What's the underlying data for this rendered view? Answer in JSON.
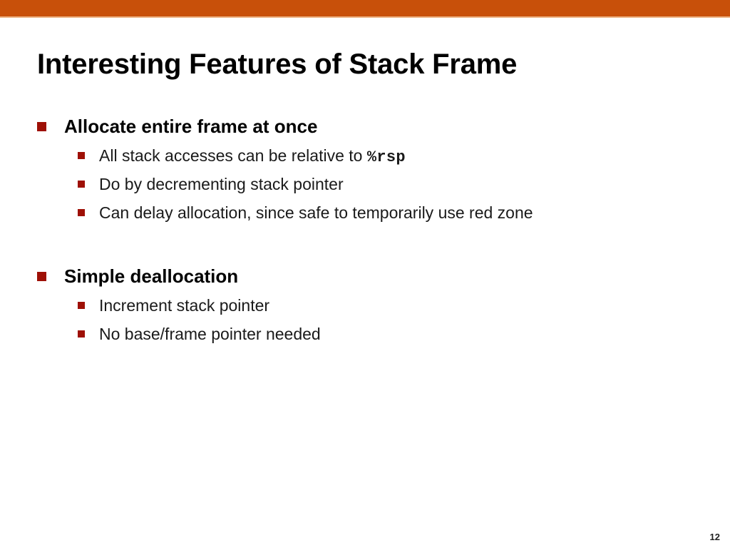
{
  "slide": {
    "title": "Interesting Features of Stack Frame",
    "page_number": "12",
    "accent_bar_color": "#c8500a",
    "bullet_color": "#9e1006",
    "text_color": "#000000",
    "background_color": "#ffffff"
  },
  "groups": [
    {
      "heading": "Allocate entire frame at once",
      "items": [
        {
          "prefix": "All stack accesses can be relative to ",
          "code": "%rsp",
          "suffix": ""
        },
        {
          "prefix": "Do by decrementing stack pointer",
          "code": "",
          "suffix": ""
        },
        {
          "prefix": "Can delay allocation, since safe to temporarily use red zone",
          "code": "",
          "suffix": ""
        }
      ]
    },
    {
      "heading": "Simple deallocation",
      "items": [
        {
          "prefix": "Increment stack pointer",
          "code": "",
          "suffix": ""
        },
        {
          "prefix": "No base/frame pointer needed",
          "code": "",
          "suffix": ""
        }
      ]
    }
  ]
}
